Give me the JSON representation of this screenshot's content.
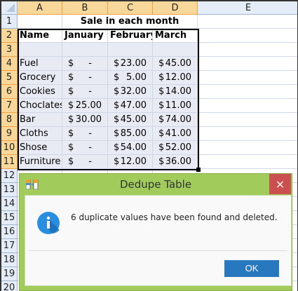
{
  "columns": [
    "A",
    "B",
    "C",
    "D",
    "E"
  ],
  "rows": [
    "1",
    "2",
    "3",
    "4",
    "5",
    "6",
    "7",
    "8",
    "9",
    "10",
    "11",
    "12",
    "13",
    "14",
    "15",
    "16",
    "17",
    "18",
    "19",
    "20"
  ],
  "title_cell": "Sale in each month",
  "headers": [
    "Name",
    "January",
    "February",
    "March"
  ],
  "currency": "$",
  "data": [
    [
      "Fuel",
      "-",
      "23.00",
      "45.00"
    ],
    [
      "Grocery",
      "-",
      "5.00",
      "12.00"
    ],
    [
      "Cookies",
      "-",
      "32.00",
      "14.00"
    ],
    [
      "Choclates",
      "25.00",
      "47.00",
      "11.00"
    ],
    [
      "Bar",
      "30.00",
      "45.00",
      "74.00"
    ],
    [
      "Cloths",
      "-",
      "85.00",
      "41.00"
    ],
    [
      "Shose",
      "-",
      "54.00",
      "52.00"
    ],
    [
      "Furniture",
      "-",
      "12.00",
      "36.00"
    ]
  ],
  "dialog": {
    "title": "Dedupe Table",
    "message": "6 duplicate values have been found and deleted.",
    "ok": "OK",
    "close": "×"
  }
}
